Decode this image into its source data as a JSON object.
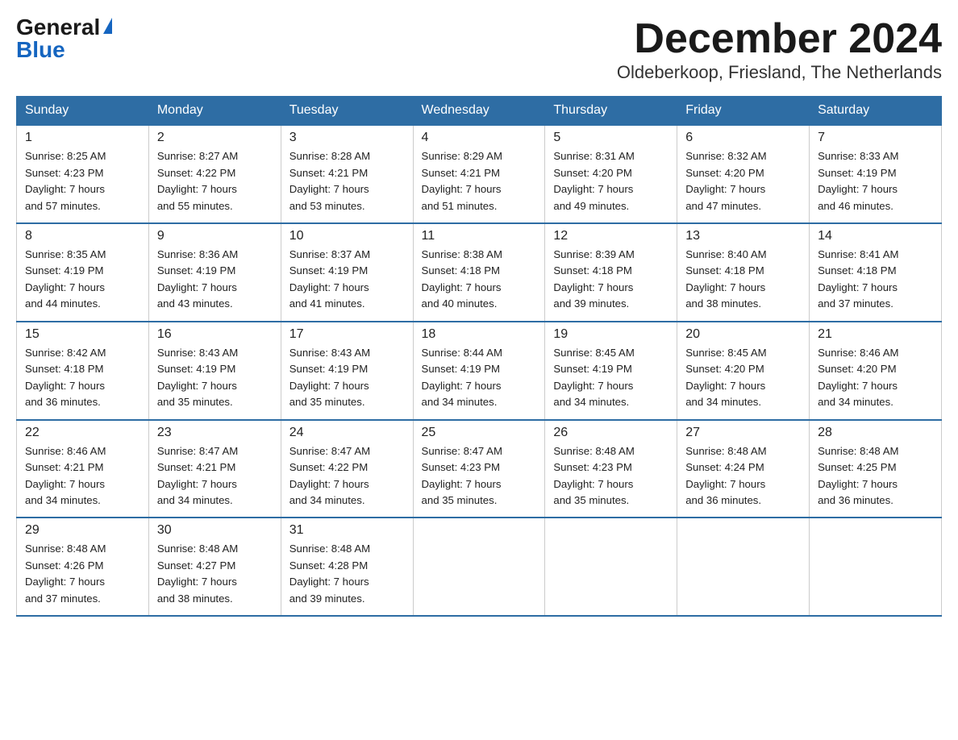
{
  "logo": {
    "general": "General",
    "blue": "Blue",
    "triangle": "▶"
  },
  "title": "December 2024",
  "location": "Oldeberkoop, Friesland, The Netherlands",
  "days_of_week": [
    "Sunday",
    "Monday",
    "Tuesday",
    "Wednesday",
    "Thursday",
    "Friday",
    "Saturday"
  ],
  "weeks": [
    [
      {
        "day": "1",
        "info": "Sunrise: 8:25 AM\nSunset: 4:23 PM\nDaylight: 7 hours\nand 57 minutes."
      },
      {
        "day": "2",
        "info": "Sunrise: 8:27 AM\nSunset: 4:22 PM\nDaylight: 7 hours\nand 55 minutes."
      },
      {
        "day": "3",
        "info": "Sunrise: 8:28 AM\nSunset: 4:21 PM\nDaylight: 7 hours\nand 53 minutes."
      },
      {
        "day": "4",
        "info": "Sunrise: 8:29 AM\nSunset: 4:21 PM\nDaylight: 7 hours\nand 51 minutes."
      },
      {
        "day": "5",
        "info": "Sunrise: 8:31 AM\nSunset: 4:20 PM\nDaylight: 7 hours\nand 49 minutes."
      },
      {
        "day": "6",
        "info": "Sunrise: 8:32 AM\nSunset: 4:20 PM\nDaylight: 7 hours\nand 47 minutes."
      },
      {
        "day": "7",
        "info": "Sunrise: 8:33 AM\nSunset: 4:19 PM\nDaylight: 7 hours\nand 46 minutes."
      }
    ],
    [
      {
        "day": "8",
        "info": "Sunrise: 8:35 AM\nSunset: 4:19 PM\nDaylight: 7 hours\nand 44 minutes."
      },
      {
        "day": "9",
        "info": "Sunrise: 8:36 AM\nSunset: 4:19 PM\nDaylight: 7 hours\nand 43 minutes."
      },
      {
        "day": "10",
        "info": "Sunrise: 8:37 AM\nSunset: 4:19 PM\nDaylight: 7 hours\nand 41 minutes."
      },
      {
        "day": "11",
        "info": "Sunrise: 8:38 AM\nSunset: 4:18 PM\nDaylight: 7 hours\nand 40 minutes."
      },
      {
        "day": "12",
        "info": "Sunrise: 8:39 AM\nSunset: 4:18 PM\nDaylight: 7 hours\nand 39 minutes."
      },
      {
        "day": "13",
        "info": "Sunrise: 8:40 AM\nSunset: 4:18 PM\nDaylight: 7 hours\nand 38 minutes."
      },
      {
        "day": "14",
        "info": "Sunrise: 8:41 AM\nSunset: 4:18 PM\nDaylight: 7 hours\nand 37 minutes."
      }
    ],
    [
      {
        "day": "15",
        "info": "Sunrise: 8:42 AM\nSunset: 4:18 PM\nDaylight: 7 hours\nand 36 minutes."
      },
      {
        "day": "16",
        "info": "Sunrise: 8:43 AM\nSunset: 4:19 PM\nDaylight: 7 hours\nand 35 minutes."
      },
      {
        "day": "17",
        "info": "Sunrise: 8:43 AM\nSunset: 4:19 PM\nDaylight: 7 hours\nand 35 minutes."
      },
      {
        "day": "18",
        "info": "Sunrise: 8:44 AM\nSunset: 4:19 PM\nDaylight: 7 hours\nand 34 minutes."
      },
      {
        "day": "19",
        "info": "Sunrise: 8:45 AM\nSunset: 4:19 PM\nDaylight: 7 hours\nand 34 minutes."
      },
      {
        "day": "20",
        "info": "Sunrise: 8:45 AM\nSunset: 4:20 PM\nDaylight: 7 hours\nand 34 minutes."
      },
      {
        "day": "21",
        "info": "Sunrise: 8:46 AM\nSunset: 4:20 PM\nDaylight: 7 hours\nand 34 minutes."
      }
    ],
    [
      {
        "day": "22",
        "info": "Sunrise: 8:46 AM\nSunset: 4:21 PM\nDaylight: 7 hours\nand 34 minutes."
      },
      {
        "day": "23",
        "info": "Sunrise: 8:47 AM\nSunset: 4:21 PM\nDaylight: 7 hours\nand 34 minutes."
      },
      {
        "day": "24",
        "info": "Sunrise: 8:47 AM\nSunset: 4:22 PM\nDaylight: 7 hours\nand 34 minutes."
      },
      {
        "day": "25",
        "info": "Sunrise: 8:47 AM\nSunset: 4:23 PM\nDaylight: 7 hours\nand 35 minutes."
      },
      {
        "day": "26",
        "info": "Sunrise: 8:48 AM\nSunset: 4:23 PM\nDaylight: 7 hours\nand 35 minutes."
      },
      {
        "day": "27",
        "info": "Sunrise: 8:48 AM\nSunset: 4:24 PM\nDaylight: 7 hours\nand 36 minutes."
      },
      {
        "day": "28",
        "info": "Sunrise: 8:48 AM\nSunset: 4:25 PM\nDaylight: 7 hours\nand 36 minutes."
      }
    ],
    [
      {
        "day": "29",
        "info": "Sunrise: 8:48 AM\nSunset: 4:26 PM\nDaylight: 7 hours\nand 37 minutes."
      },
      {
        "day": "30",
        "info": "Sunrise: 8:48 AM\nSunset: 4:27 PM\nDaylight: 7 hours\nand 38 minutes."
      },
      {
        "day": "31",
        "info": "Sunrise: 8:48 AM\nSunset: 4:28 PM\nDaylight: 7 hours\nand 39 minutes."
      },
      {
        "day": "",
        "info": ""
      },
      {
        "day": "",
        "info": ""
      },
      {
        "day": "",
        "info": ""
      },
      {
        "day": "",
        "info": ""
      }
    ]
  ]
}
